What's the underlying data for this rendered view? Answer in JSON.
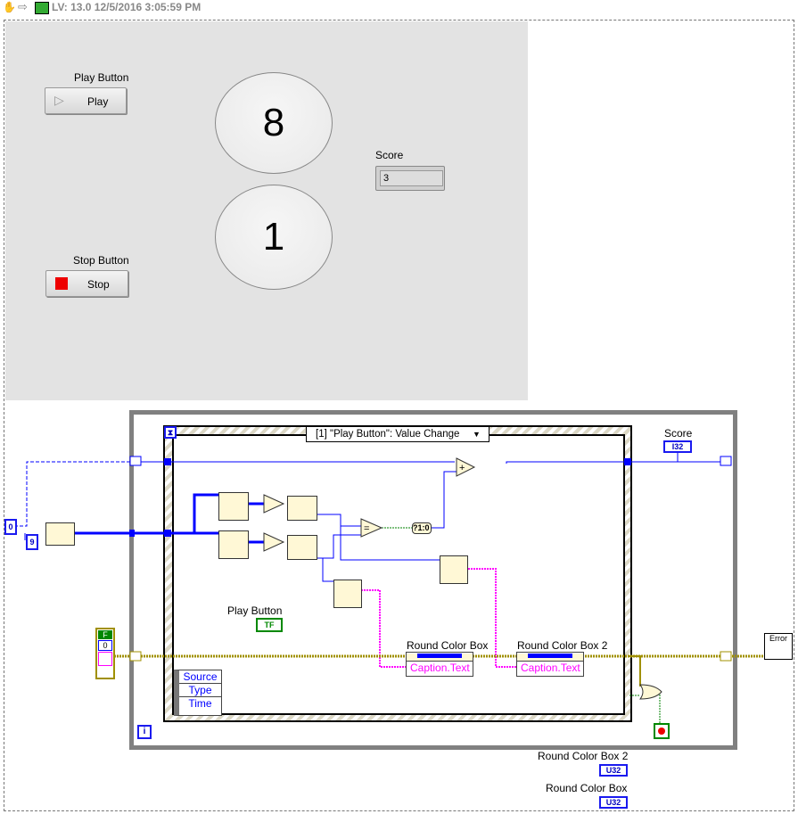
{
  "titlebar": {
    "title": "LV: 13.0 12/5/2016 3:05:59 PM",
    "icons": [
      "hand-icon",
      "run-arrow-icon",
      "vi-icon"
    ]
  },
  "front_panel": {
    "play_button": {
      "label": "Play Button",
      "text": "Play"
    },
    "stop_button": {
      "label": "Stop Button",
      "text": "Stop"
    },
    "round_box_1": {
      "value": "8"
    },
    "round_box_2": {
      "value": "1"
    },
    "score": {
      "label": "Score",
      "value": "3"
    }
  },
  "diagram": {
    "event_case": "[1] \"Play Button\": Value Change",
    "score_terminal": {
      "label": "Score",
      "type": "I32"
    },
    "constant_zero": "0",
    "constant_nine": "9",
    "cluster_const": {
      "bool": "F",
      "num": "0"
    },
    "play_button_terminal": {
      "label": "Play Button",
      "type": "TF"
    },
    "property_node_1": {
      "label": "Round Color Box",
      "property": "Caption.Text"
    },
    "property_node_2": {
      "label": "Round Color Box 2",
      "property": "Caption.Text"
    },
    "event_data": [
      "Source",
      "Type",
      "Time"
    ],
    "bool_to_num": "?1:0",
    "error_handler": "Error",
    "ref_2": {
      "label": "Round Color Box 2",
      "type": "U32"
    },
    "ref_1": {
      "label": "Round Color Box",
      "type": "U32"
    },
    "iteration": "i",
    "colors": {
      "numeric_wire": "#0000ff",
      "string_wire": "#ff00ff",
      "bool_wire": "#008000",
      "error_wire": "#a09000",
      "panel_bg": "#e3e3e3"
    }
  }
}
